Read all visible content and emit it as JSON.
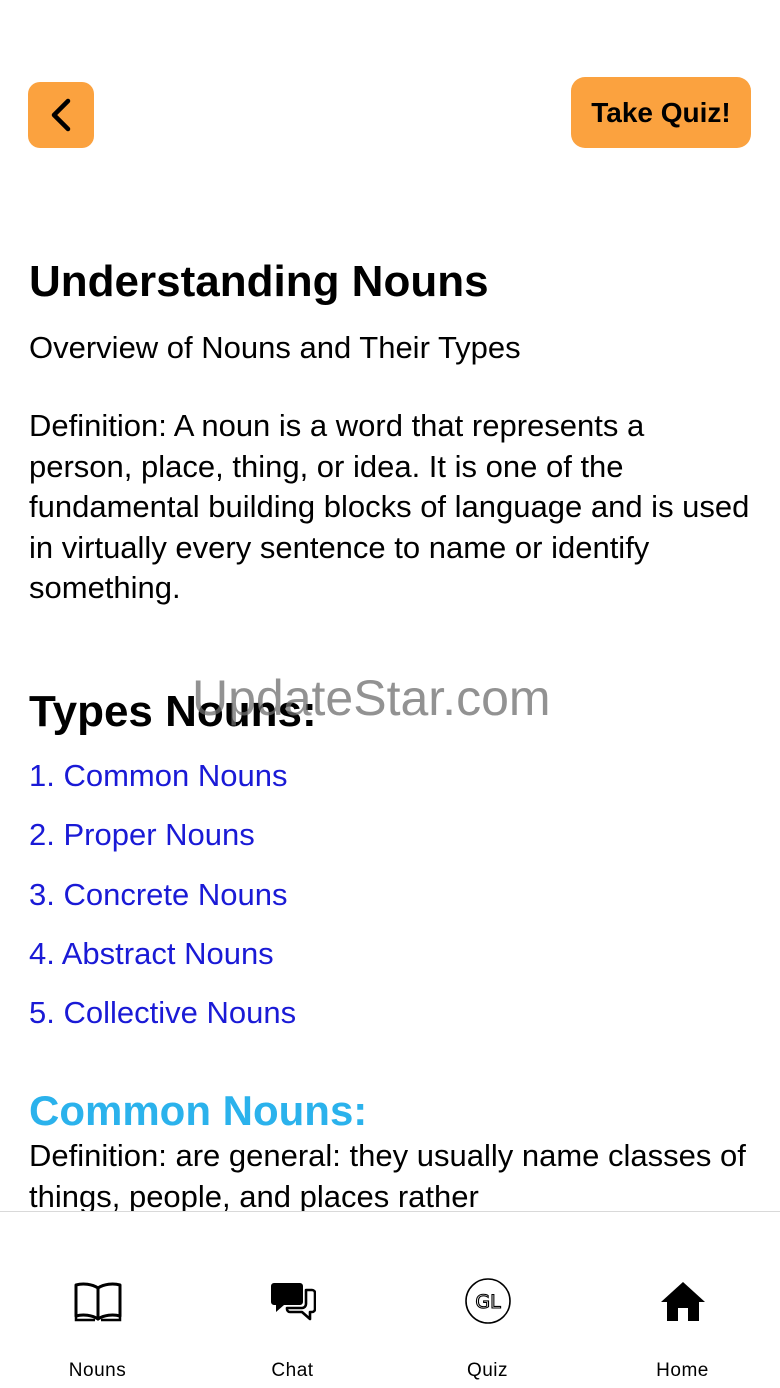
{
  "header": {
    "back_label": "",
    "quiz_label": "Take Quiz!"
  },
  "main": {
    "title": "Understanding Nouns",
    "subtitle": "Overview of Nouns and Their Types",
    "definition": "Definition: A noun is a word that represents a person, place, thing, or idea. It is one of the fundamental building blocks of language and is used in virtually every sentence to name or identify something.",
    "types_heading": "Types Nouns:",
    "types": [
      "1. Common Nouns",
      "2. Proper Nouns",
      "3. Concrete Nouns",
      "4. Abstract Nouns",
      "5. Collective Nouns"
    ],
    "section_heading": "Common Nouns:",
    "section_body": "Definition: are general: they usually name classes of things, people, and places rather"
  },
  "watermark": "UpdateStar.com",
  "tabbar": {
    "tabs": [
      {
        "label": "Nouns",
        "icon": "book-icon"
      },
      {
        "label": "Chat",
        "icon": "chat-icon"
      },
      {
        "label": "Quiz",
        "icon": "gl-badge-icon"
      },
      {
        "label": "Home",
        "icon": "home-icon"
      }
    ]
  },
  "colors": {
    "accent": "#fba23f",
    "link": "#1a1ad6",
    "section_heading": "#2bb2ec"
  }
}
